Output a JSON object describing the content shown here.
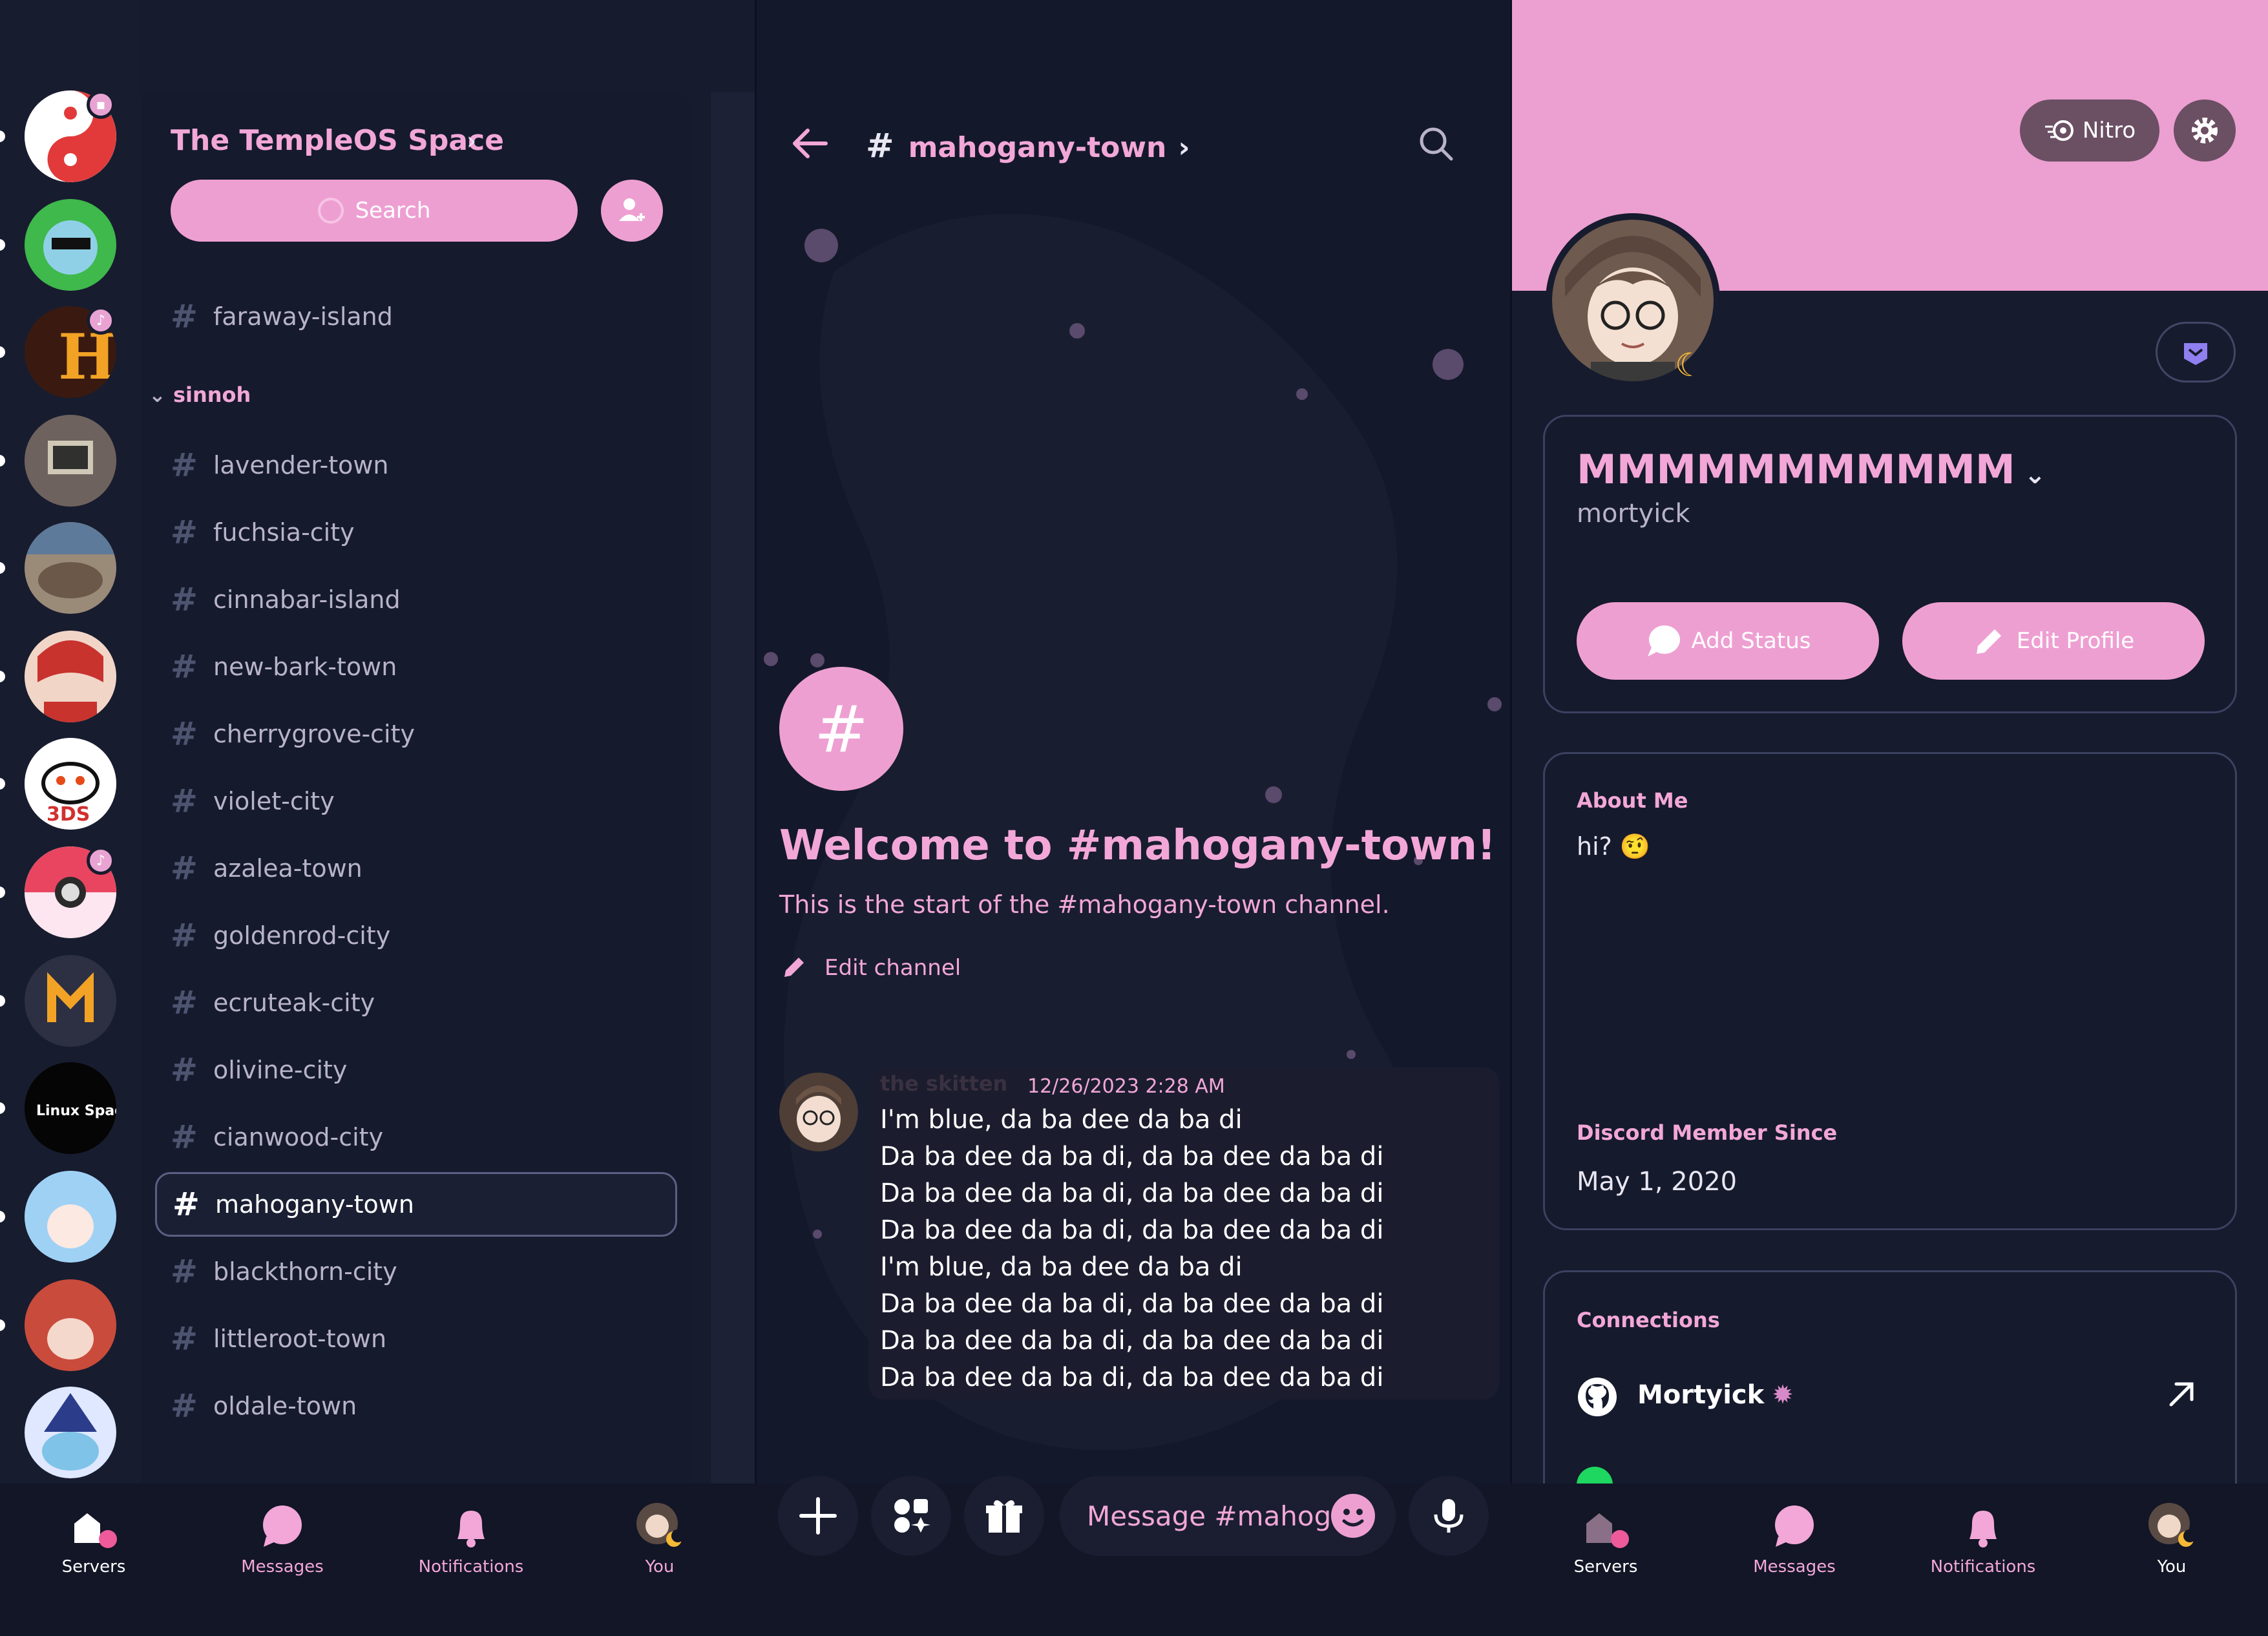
{
  "colors": {
    "accent": "#ee9fd2",
    "accent_text": "#f2a7d8",
    "background": "#14182b",
    "banner": "#ec9fd1"
  },
  "left": {
    "server_name": "The TempleOS Space",
    "search_label": "Search",
    "channels_top": [
      {
        "name": "faraway-island"
      }
    ],
    "category": "sinnoh",
    "channels": [
      {
        "name": "lavender-town"
      },
      {
        "name": "fuchsia-city"
      },
      {
        "name": "cinnabar-island"
      },
      {
        "name": "new-bark-town"
      },
      {
        "name": "cherrygrove-city"
      },
      {
        "name": "violet-city"
      },
      {
        "name": "azalea-town"
      },
      {
        "name": "goldenrod-city"
      },
      {
        "name": "ecruteak-city"
      },
      {
        "name": "olivine-city"
      },
      {
        "name": "cianwood-city"
      },
      {
        "name": "mahogany-town"
      },
      {
        "name": "blackthorn-city"
      },
      {
        "name": "littleroot-town"
      },
      {
        "name": "oldale-town"
      }
    ],
    "servers": [
      "yin-yang-server",
      "rick-server",
      "h-server",
      "computer-server",
      "cat-server",
      "anime-server",
      "reddit-3ds-server",
      "pokeball-server",
      "m-server",
      "linux-space-server",
      "blue-hair-server",
      "red-hair-server",
      "wizard-server"
    ],
    "server_badges": {
      "reddit_3ds_text": "3DS",
      "linux_space_text": "Linux Space"
    }
  },
  "nav": {
    "servers": "Servers",
    "messages": "Messages",
    "notifications": "Notifications",
    "you": "You"
  },
  "mid": {
    "channel_name": "mahogany-town",
    "welcome_title": "Welcome to #mahogany-town!",
    "welcome_sub": "This is the start of the #mahogany-town channel.",
    "edit_channel": "Edit channel",
    "message": {
      "author": "the skitten",
      "timestamp": "12/26/2023 2:28 AM",
      "lines": [
        "I'm blue, da ba dee da ba di",
        "Da ba dee da ba di, da ba dee da ba di",
        "Da ba dee da ba di, da ba dee da ba di",
        "Da ba dee da ba di, da ba dee da ba di",
        "I'm blue, da ba dee da ba di",
        "Da ba dee da ba di, da ba dee da ba di",
        "Da ba dee da ba di, da ba dee da ba di",
        "Da ba dee da ba di, da ba dee da ba di"
      ]
    },
    "composer_placeholder": "Message #mahog..."
  },
  "right": {
    "nitro_label": "Nitro",
    "display_name": "MMMMMMMMMMM",
    "username": "mortyick",
    "add_status": "Add Status",
    "edit_profile": "Edit Profile",
    "about_title": "About Me",
    "about_body": "hi? 🤨",
    "member_since_title": "Discord Member Since",
    "member_since": "May 1, 2020",
    "connections_title": "Connections",
    "connection_name": "Mortyick"
  }
}
